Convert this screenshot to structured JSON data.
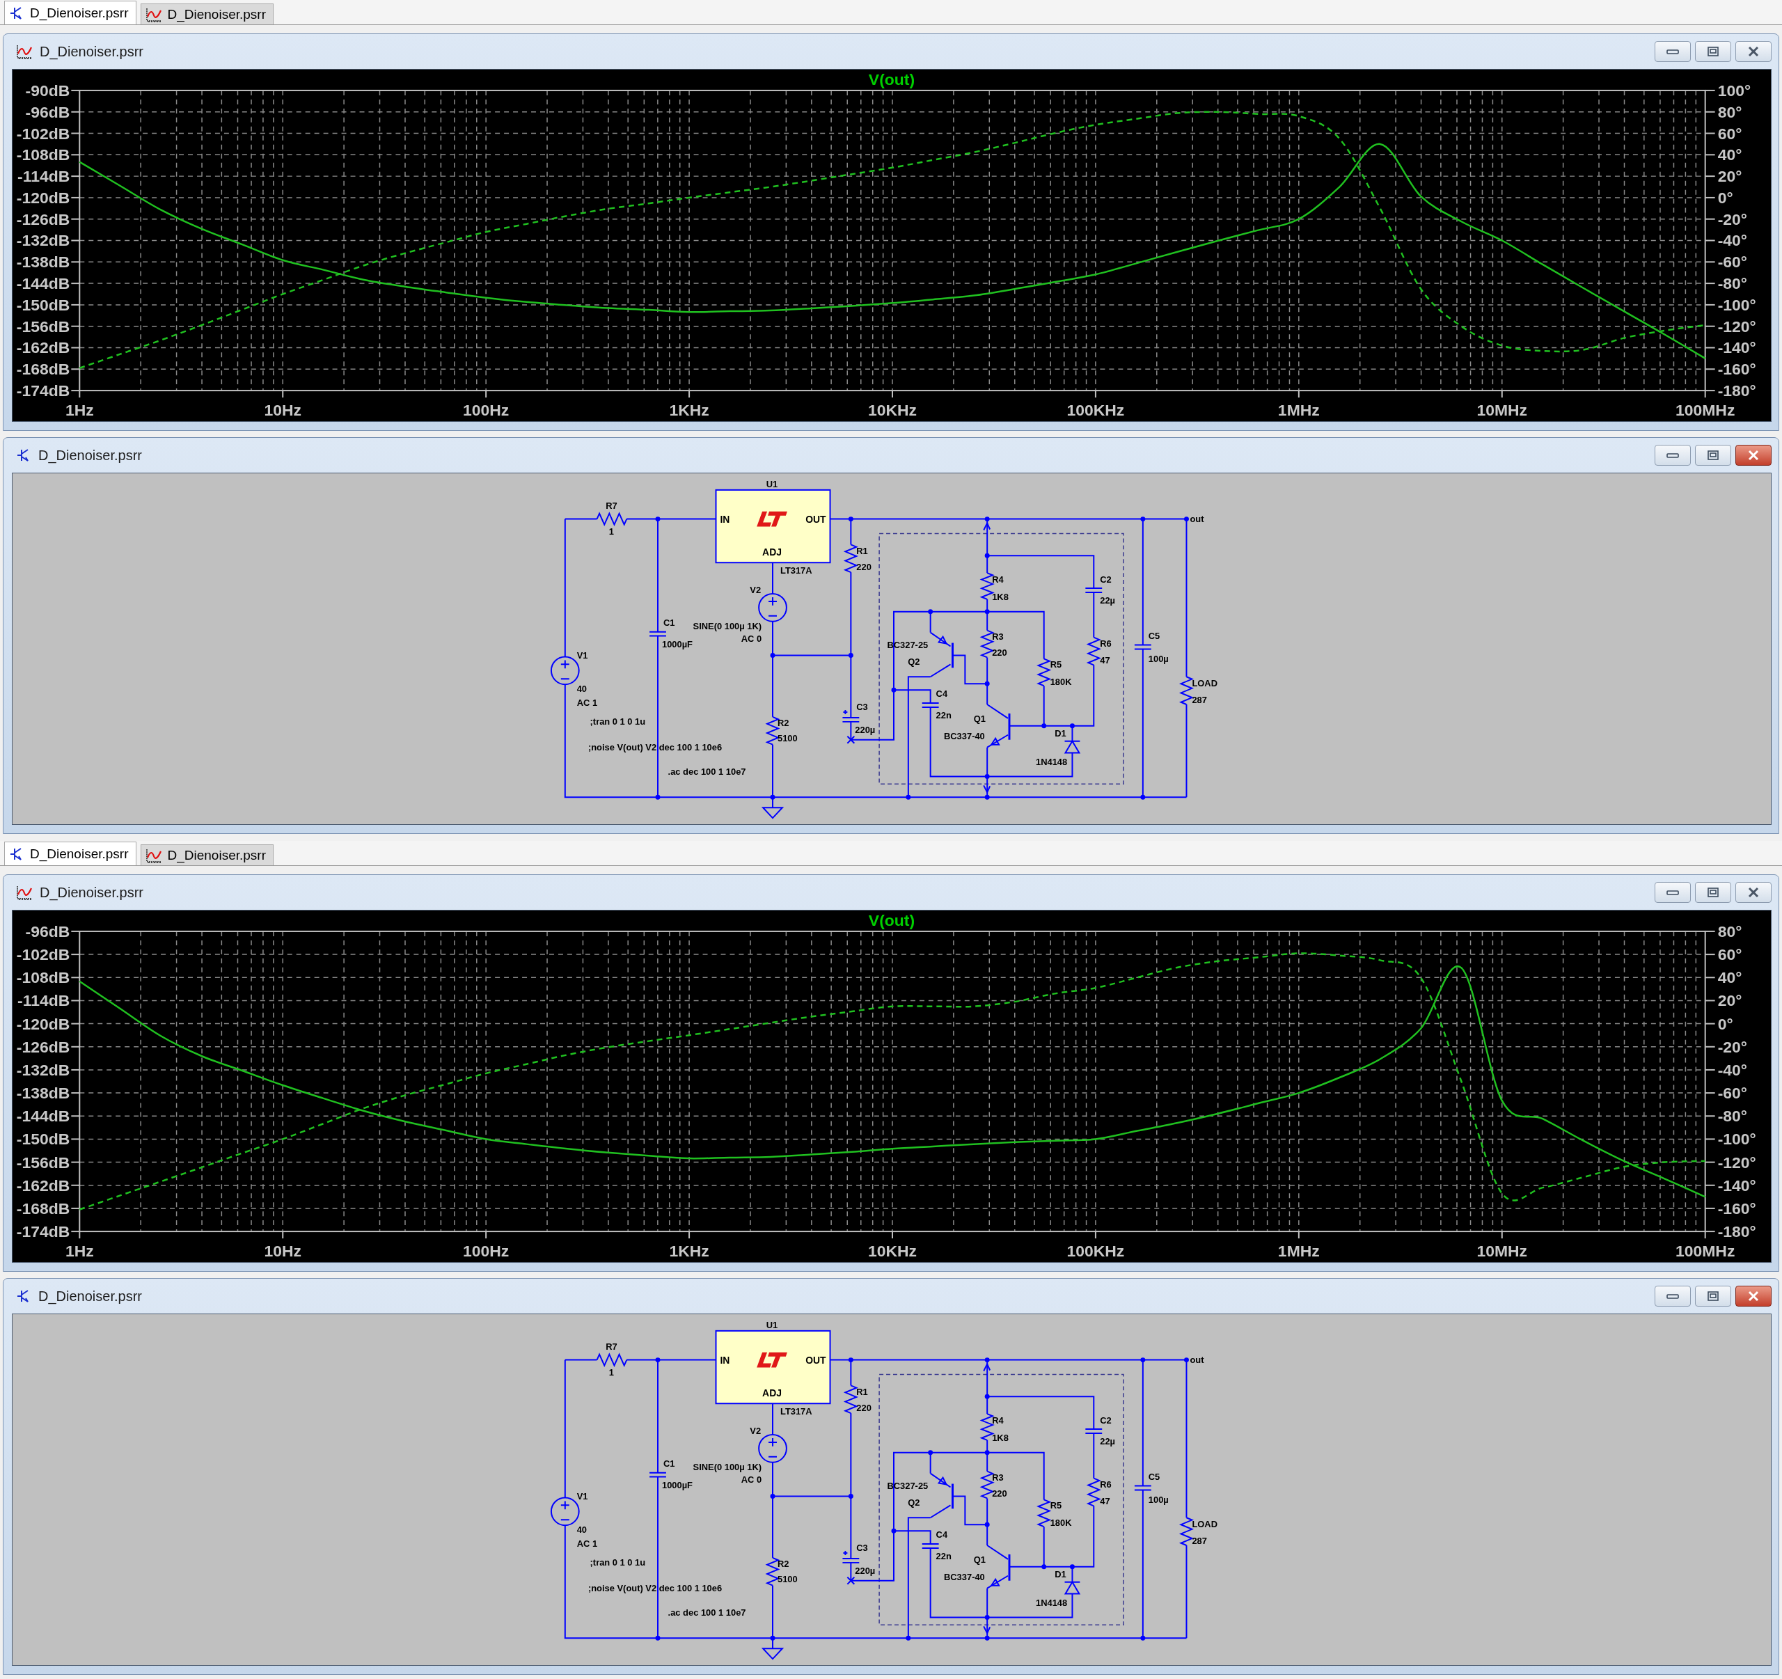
{
  "panes": [
    {
      "tabs": [
        {
          "label": "D_Dienoiser.psrr",
          "kind": "schematic",
          "selected": true
        },
        {
          "label": "D_Dienoiser.psrr",
          "kind": "plot",
          "selected": false
        }
      ],
      "windows": [
        {
          "kind": "plot",
          "title": "D_Dienoiser.psrr",
          "active": false,
          "chart_data": {
            "type": "line",
            "title": "V(out)",
            "categories": [
              "1Hz",
              null,
              null,
              null,
              null,
              "10Hz",
              null,
              null,
              null,
              null,
              "100Hz",
              null,
              null,
              null,
              null,
              "1KHz",
              null,
              null,
              null,
              null,
              "10KHz",
              null,
              null,
              null,
              null,
              "100KHz",
              null,
              null,
              null,
              null,
              "1MHz",
              null,
              null,
              null,
              null,
              "10MHz",
              null,
              null,
              null,
              null,
              "100MHz"
            ],
            "grid": true,
            "ylim": [
              -174,
              -90
            ],
            "y2lim": [
              -180,
              100
            ],
            "yticks": [
              {
                "value": -90,
                "label": "-90dB"
              },
              {
                "value": -96,
                "label": "-96dB"
              },
              {
                "value": -102,
                "label": "-102dB"
              },
              {
                "value": -108,
                "label": "-108dB"
              },
              {
                "value": -114,
                "label": "-114dB"
              },
              {
                "value": -120,
                "label": "-120dB"
              },
              {
                "value": -126,
                "label": "-126dB"
              },
              {
                "value": -132,
                "label": "-132dB"
              },
              {
                "value": -138,
                "label": "-138dB"
              },
              {
                "value": -144,
                "label": "-144dB"
              },
              {
                "value": -150,
                "label": "-150dB"
              },
              {
                "value": -156,
                "label": "-156dB"
              },
              {
                "value": -162,
                "label": "-162dB"
              },
              {
                "value": -168,
                "label": "-168dB"
              },
              {
                "value": -174,
                "label": "-174dB"
              }
            ],
            "y2ticks": [
              {
                "value": 100,
                "label": "100°"
              },
              {
                "value": 80,
                "label": "80°"
              },
              {
                "value": 60,
                "label": "60°"
              },
              {
                "value": 40,
                "label": "40°"
              },
              {
                "value": 20,
                "label": "20°"
              },
              {
                "value": 0,
                "label": "0°"
              },
              {
                "value": -20,
                "label": "-20°"
              },
              {
                "value": -40,
                "label": "-40°"
              },
              {
                "value": -60,
                "label": "-60°"
              },
              {
                "value": -80,
                "label": "-80°"
              },
              {
                "value": -100,
                "label": "-100°"
              },
              {
                "value": -120,
                "label": "-120°"
              },
              {
                "value": -140,
                "label": "-140°"
              },
              {
                "value": -160,
                "label": "-160°"
              },
              {
                "value": -180,
                "label": "-180°"
              }
            ],
            "series": [
              {
                "color": "#20c020",
                "line_style": "solid",
                "values": [
                  -110,
                  -116.7,
                  -123.4,
                  -128.7,
                  -133.1,
                  -137.5,
                  -140.2,
                  -143,
                  -144.9,
                  -146.5,
                  -148,
                  -149.2,
                  -150.1,
                  -150.9,
                  -151.4,
                  -152,
                  -151.8,
                  -151.6,
                  -151,
                  -150.3,
                  -149.5,
                  -148.5,
                  -147.4,
                  -145.6,
                  -143.6,
                  -141.5,
                  -138.4,
                  -135.2,
                  -132.1,
                  -129.1,
                  -126,
                  -117,
                  -105,
                  -119.6,
                  -126.7,
                  -132,
                  -138.7,
                  -145.3,
                  -151.8,
                  -158.3,
                  -165
                ]
              },
              {
                "color": "#20c020",
                "axis": "y2",
                "line_style": "dashed",
                "values": [
                  -159,
                  -146,
                  -133,
                  -119,
                  -104.5,
                  -90,
                  -76.6,
                  -63.2,
                  -51.9,
                  -41.9,
                  -32,
                  -24.5,
                  -17,
                  -10.4,
                  -5.4,
                  0,
                  5,
                  10,
                  15.8,
                  21.9,
                  28,
                  35.1,
                  42.3,
                  51,
                  60.2,
                  68,
                  73.5,
                  78.8,
                  80,
                  78,
                  76,
                  55,
                  -10,
                  -85,
                  -120,
                  -138,
                  -143,
                  -142,
                  -131,
                  -124,
                  -119
                ]
              }
            ]
          }
        },
        {
          "kind": "schematic",
          "title": "D_Dienoiser.psrr",
          "active": true,
          "schematic": {
            "net_label": "out",
            "components": [
              {
                "kind": "voltage_source",
                "ref": "V1",
                "value": "40",
                "extra": "AC 1"
              },
              {
                "kind": "resistor",
                "ref": "R7",
                "value": "1"
              },
              {
                "kind": "capacitor",
                "ref": "C1",
                "value": "1000µF"
              },
              {
                "kind": "regulator",
                "ref": "U1",
                "value": "LT317A",
                "pins": [
                  "IN",
                  "OUT",
                  "ADJ"
                ]
              },
              {
                "kind": "voltage_source",
                "ref": "V2",
                "value": "SINE(0 100µ 1K)",
                "extra": "AC 0"
              },
              {
                "kind": "resistor",
                "ref": "R1",
                "value": "220"
              },
              {
                "kind": "resistor",
                "ref": "R2",
                "value": "5100"
              },
              {
                "kind": "polarized_capacitor",
                "ref": "C3",
                "value": "220µ"
              },
              {
                "kind": "resistor",
                "ref": "R4",
                "value": "1K8"
              },
              {
                "kind": "capacitor",
                "ref": "C2",
                "value": "22µ"
              },
              {
                "kind": "resistor",
                "ref": "R6",
                "value": "47"
              },
              {
                "kind": "resistor",
                "ref": "R3",
                "value": "220"
              },
              {
                "kind": "resistor",
                "ref": "R5",
                "value": "180K"
              },
              {
                "kind": "pnp",
                "ref": "Q2",
                "value": "BC327-25"
              },
              {
                "kind": "capacitor",
                "ref": "C4",
                "value": "22n"
              },
              {
                "kind": "npn",
                "ref": "Q1",
                "value": "BC337-40"
              },
              {
                "kind": "diode",
                "ref": "D1",
                "value": "1N4148"
              },
              {
                "kind": "capacitor",
                "ref": "C5",
                "value": "100µ"
              },
              {
                "kind": "resistor",
                "ref": "LOAD",
                "value": "287"
              }
            ],
            "directives": [
              ";tran 0 1 0 1u",
              ";noise V(out) V2 dec 100 1 10e6",
              ".ac dec 100 1 10e7"
            ]
          }
        }
      ]
    },
    {
      "tabs": [
        {
          "label": "D_Dienoiser.psrr",
          "kind": "schematic",
          "selected": true
        },
        {
          "label": "D_Dienoiser.psrr",
          "kind": "plot",
          "selected": false
        }
      ],
      "windows": [
        {
          "kind": "plot",
          "title": "D_Dienoiser.psrr",
          "active": false,
          "chart_data": {
            "type": "line",
            "title": "V(out)",
            "categories": [
              "1Hz",
              null,
              null,
              null,
              null,
              "10Hz",
              null,
              null,
              null,
              null,
              "100Hz",
              null,
              null,
              null,
              null,
              "1KHz",
              null,
              null,
              null,
              null,
              "10KHz",
              null,
              null,
              null,
              null,
              "100KHz",
              null,
              null,
              null,
              null,
              "1MHz",
              null,
              null,
              null,
              null,
              "10MHz",
              null,
              null,
              null,
              null,
              "100MHz"
            ],
            "grid": true,
            "ylim": [
              -174,
              -96
            ],
            "y2lim": [
              -180,
              80
            ],
            "yticks": [
              {
                "value": -96,
                "label": "-96dB"
              },
              {
                "value": -102,
                "label": "-102dB"
              },
              {
                "value": -108,
                "label": "-108dB"
              },
              {
                "value": -114,
                "label": "-114dB"
              },
              {
                "value": -120,
                "label": "-120dB"
              },
              {
                "value": -126,
                "label": "-126dB"
              },
              {
                "value": -132,
                "label": "-132dB"
              },
              {
                "value": -138,
                "label": "-138dB"
              },
              {
                "value": -144,
                "label": "-144dB"
              },
              {
                "value": -150,
                "label": "-150dB"
              },
              {
                "value": -156,
                "label": "-156dB"
              },
              {
                "value": -162,
                "label": "-162dB"
              },
              {
                "value": -168,
                "label": "-168dB"
              },
              {
                "value": -174,
                "label": "-174dB"
              }
            ],
            "y2ticks": [
              {
                "value": 80,
                "label": "80°"
              },
              {
                "value": 60,
                "label": "60°"
              },
              {
                "value": 40,
                "label": "40°"
              },
              {
                "value": 20,
                "label": "20°"
              },
              {
                "value": 0,
                "label": "0°"
              },
              {
                "value": -20,
                "label": "-20°"
              },
              {
                "value": -40,
                "label": "-40°"
              },
              {
                "value": -60,
                "label": "-60°"
              },
              {
                "value": -80,
                "label": "-80°"
              },
              {
                "value": -100,
                "label": "-100°"
              },
              {
                "value": -120,
                "label": "-120°"
              },
              {
                "value": -140,
                "label": "-140°"
              },
              {
                "value": -160,
                "label": "-160°"
              },
              {
                "value": -180,
                "label": "-180°"
              }
            ],
            "series": [
              {
                "color": "#20c020",
                "line_style": "solid",
                "values": [
                  -109,
                  -116.1,
                  -123.2,
                  -128.4,
                  -132.2,
                  -136,
                  -139.4,
                  -142.7,
                  -145.4,
                  -147.7,
                  -150,
                  -151.3,
                  -152.5,
                  -153.5,
                  -154.3,
                  -155,
                  -154.8,
                  -154.6,
                  -154,
                  -153.3,
                  -152.5,
                  -151.9,
                  -151.3,
                  -150.8,
                  -150.4,
                  -150,
                  -147.9,
                  -145.8,
                  -143.4,
                  -140.7,
                  -138,
                  -134,
                  -129.2,
                  -121.3,
                  -105.5,
                  -140,
                  -144.7,
                  -150.4,
                  -155.7,
                  -160.3,
                  -165
                ]
              },
              {
                "color": "#20c020",
                "axis": "y2",
                "line_style": "dashed",
                "values": [
                  -161,
                  -148.8,
                  -136.7,
                  -124.5,
                  -112.2,
                  -100,
                  -86.6,
                  -73.2,
                  -62.1,
                  -52.6,
                  -43,
                  -35,
                  -27,
                  -20.4,
                  -15.1,
                  -10,
                  -4.6,
                  0.8,
                  6.1,
                  10.6,
                  15,
                  15,
                  15,
                  19,
                  26.1,
                  31,
                  39.8,
                  48.6,
                  54.1,
                  57.5,
                  61,
                  59,
                  55,
                  40,
                  -50,
                  -147,
                  -142,
                  -133,
                  -124,
                  -120,
                  -119
                ]
              }
            ]
          }
        },
        {
          "kind": "schematic",
          "title": "D_Dienoiser.psrr",
          "active": true,
          "schematic": {
            "net_label": "out",
            "components": [
              {
                "kind": "voltage_source",
                "ref": "V1",
                "value": "40",
                "extra": "AC 1"
              },
              {
                "kind": "resistor",
                "ref": "R7",
                "value": "1"
              },
              {
                "kind": "capacitor",
                "ref": "C1",
                "value": "1000µF"
              },
              {
                "kind": "regulator",
                "ref": "U1",
                "value": "LT317A",
                "pins": [
                  "IN",
                  "OUT",
                  "ADJ"
                ]
              },
              {
                "kind": "voltage_source",
                "ref": "V2",
                "value": "SINE(0 100µ 1K)",
                "extra": "AC 0"
              },
              {
                "kind": "resistor",
                "ref": "R1",
                "value": "220"
              },
              {
                "kind": "resistor",
                "ref": "R2",
                "value": "5100"
              },
              {
                "kind": "polarized_capacitor",
                "ref": "C3",
                "value": "220µ"
              },
              {
                "kind": "resistor",
                "ref": "R4",
                "value": "1K8"
              },
              {
                "kind": "capacitor",
                "ref": "C2",
                "value": "22µ"
              },
              {
                "kind": "resistor",
                "ref": "R6",
                "value": "47"
              },
              {
                "kind": "resistor",
                "ref": "R3",
                "value": "220"
              },
              {
                "kind": "resistor",
                "ref": "R5",
                "value": "180K"
              },
              {
                "kind": "pnp",
                "ref": "Q2",
                "value": "BC327-25"
              },
              {
                "kind": "capacitor",
                "ref": "C4",
                "value": "22n"
              },
              {
                "kind": "npn",
                "ref": "Q1",
                "value": "BC337-40"
              },
              {
                "kind": "diode",
                "ref": "D1",
                "value": "1N4148"
              },
              {
                "kind": "capacitor",
                "ref": "C5",
                "value": "100µ"
              },
              {
                "kind": "resistor",
                "ref": "LOAD",
                "value": "287"
              }
            ],
            "directives": [
              ";tran 0 1 0 1u",
              ";noise V(out) V2 dec 100 1 10e6",
              ".ac dec 100 1 10e7"
            ]
          }
        }
      ]
    }
  ]
}
